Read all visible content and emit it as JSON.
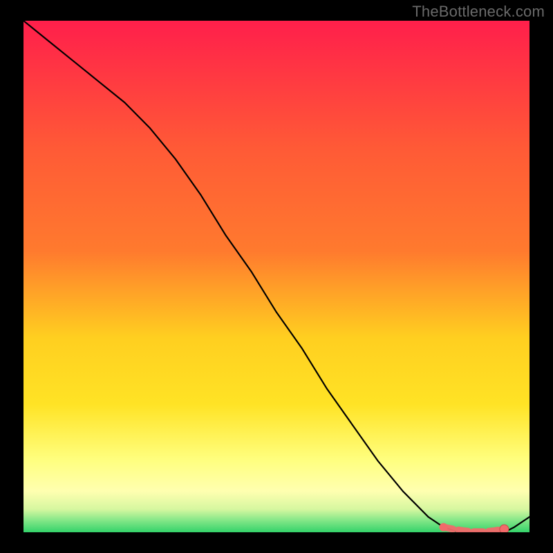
{
  "watermark": "TheBottleneck.com",
  "colors": {
    "gradient_top": "#ff1f4b",
    "gradient_mid1": "#ff7a2e",
    "gradient_mid2": "#ffe325",
    "gradient_low": "#ffffb0",
    "gradient_bottom": "#34d36a",
    "line": "#000000",
    "marker_fill": "#f26a6a",
    "marker_stroke": "#c74b4b"
  },
  "chart_data": {
    "type": "line",
    "title": "",
    "xlabel": "",
    "ylabel": "",
    "xlim": [
      0,
      100
    ],
    "ylim": [
      0,
      100
    ],
    "series": [
      {
        "name": "curve",
        "x": [
          0,
          5,
          10,
          15,
          20,
          25,
          30,
          35,
          40,
          45,
          50,
          55,
          60,
          65,
          70,
          75,
          80,
          83,
          86,
          89,
          92,
          95,
          97,
          100
        ],
        "y": [
          100,
          96,
          92,
          88,
          84,
          79,
          73,
          66,
          58,
          51,
          43,
          36,
          28,
          21,
          14,
          8,
          3,
          1,
          0,
          0,
          0,
          0,
          1,
          3
        ]
      }
    ],
    "markers": {
      "name": "highlight",
      "x": [
        83,
        85,
        87,
        89,
        91,
        93,
        95
      ],
      "y": [
        1,
        0.6,
        0.3,
        0.1,
        0.1,
        0.3,
        0.6
      ]
    },
    "vertical_marker_x": 95
  }
}
